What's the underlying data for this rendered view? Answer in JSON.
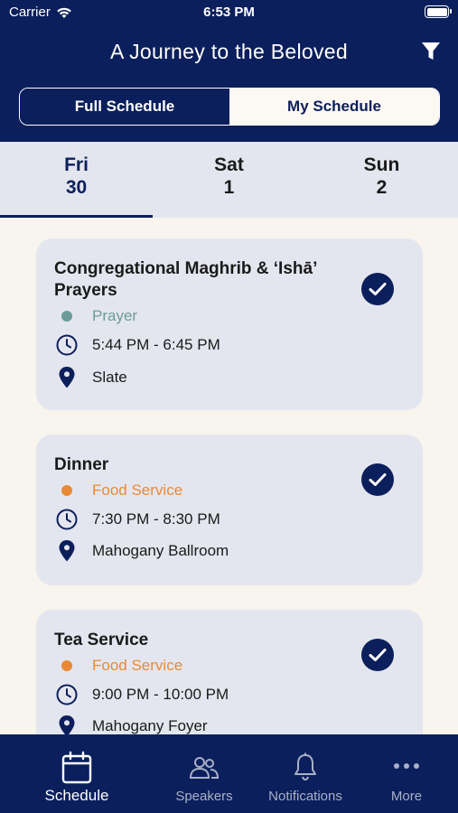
{
  "status_bar": {
    "carrier": "Carrier",
    "time": "6:53 PM"
  },
  "header": {
    "title": "A Journey to the Beloved",
    "filter_icon": "filter-icon",
    "segments": {
      "full": "Full Schedule",
      "mine": "My Schedule",
      "selected": "mine"
    }
  },
  "days": [
    {
      "name": "Fri",
      "num": "30",
      "active": true
    },
    {
      "name": "Sat",
      "num": "1",
      "active": false
    },
    {
      "name": "Sun",
      "num": "2",
      "active": false
    }
  ],
  "events": [
    {
      "title": "Congregational Maghrib & ‘Ishā’ Prayers",
      "category": "Prayer",
      "category_color": "#6b9c98",
      "time": "5:44 PM - 6:45 PM",
      "location": "Slate",
      "added": true
    },
    {
      "title": "Dinner",
      "category": "Food Service",
      "category_color": "#e88a35",
      "time": "7:30 PM - 8:30 PM",
      "location": "Mahogany Ballroom",
      "added": true
    },
    {
      "title": "Tea Service",
      "category": "Food Service",
      "category_color": "#e88a35",
      "time": "9:00 PM - 10:00 PM",
      "location": "Mahogany Foyer",
      "added": true
    }
  ],
  "tabbar": {
    "schedule": "Schedule",
    "speakers": "Speakers",
    "notifications": "Notifications",
    "more": "More"
  },
  "colors": {
    "navy": "#0b1f5c",
    "card_bg": "#e4e6ef",
    "page_bg": "#f8f4ee"
  }
}
